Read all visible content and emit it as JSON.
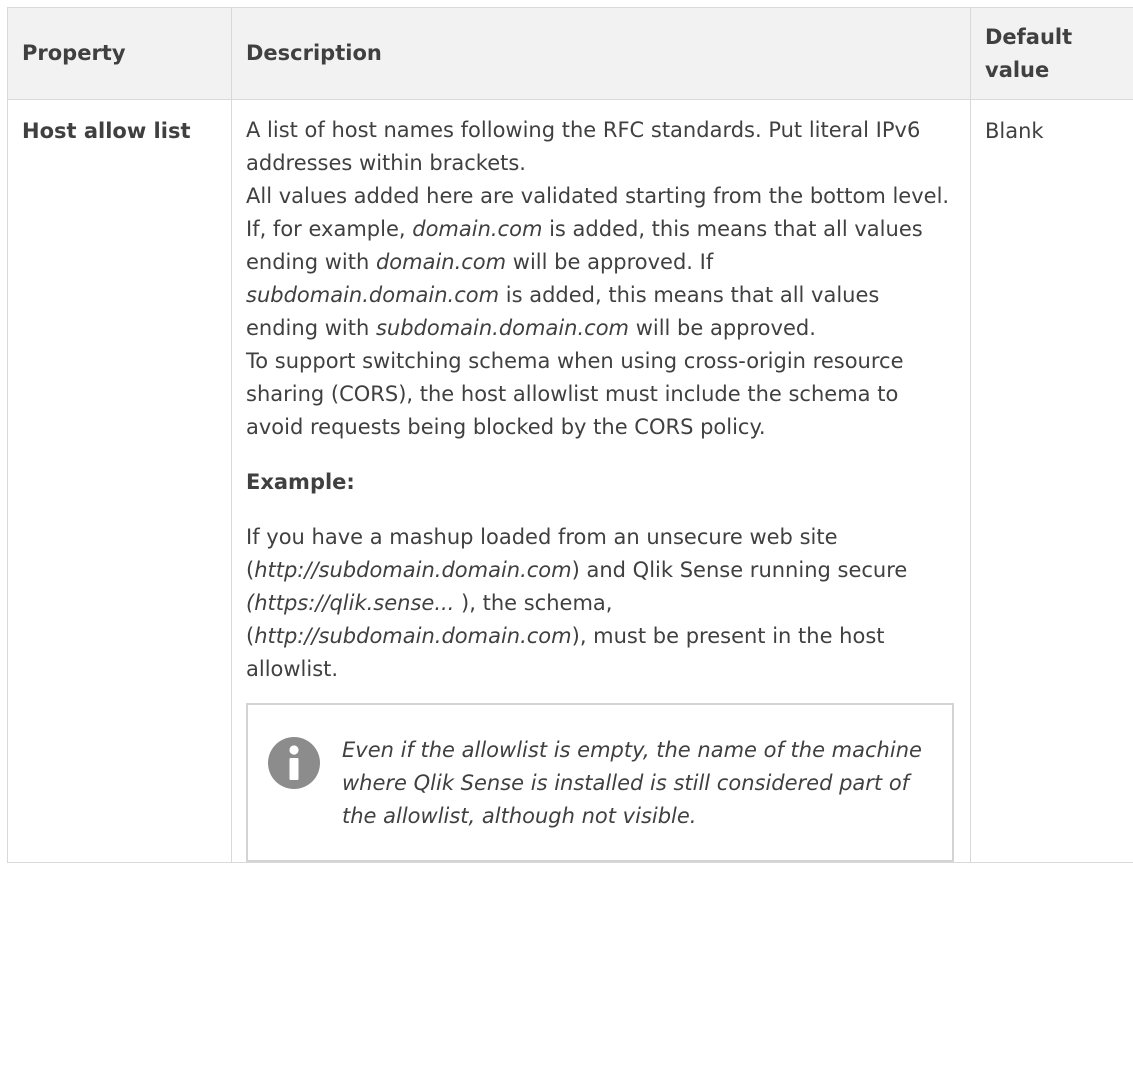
{
  "table": {
    "headers": {
      "property": "Property",
      "description": "Description",
      "default_line1": "Default",
      "default_line2": "value"
    },
    "rows": [
      {
        "property": "Host allow list",
        "default": "Blank",
        "description": {
          "line1": "A list of host names following the RFC standards. Put literal IPv6 addresses within brackets.",
          "p2_a": "All values added here are validated starting from the bottom level. If, for example, ",
          "p2_b_italic": "domain.com",
          "p2_c": " is added, this means that all values ending with ",
          "p2_d_italic": "domain.com",
          "p2_e": " will be approved. If ",
          "p2_f_italic": "subdomain.domain.com",
          "p2_g": " is added, this means that all values ending with ",
          "p2_h_italic": "subdomain.domain.com",
          "p2_i": " will be approved.",
          "p3": "To support switching schema when using cross-origin resource sharing (CORS), the host allowlist must include the schema to avoid requests being blocked by the CORS policy.",
          "example_heading": "Example:",
          "ex_a": "If you have a mashup loaded from an unsecure web site (",
          "ex_b_italic": "http://subdomain.domain.com",
          "ex_c": ") and Qlik Sense running secure ",
          "ex_d_italic": "(https://qlik.sense... ",
          "ex_e": "), the schema, (",
          "ex_f_italic": "http://subdomain.domain.com",
          "ex_g": "), must be present in the host allowlist.",
          "note": "Even if the allowlist is empty, the name of the machine where Qlik Sense is installed is still considered part of the allowlist, although not visible."
        }
      }
    ]
  },
  "icons": {
    "note_icon": "info-icon"
  },
  "colors": {
    "header_bg": "#f2f2f2",
    "border": "#d9d9d9",
    "text": "#404040",
    "icon": "#8c8c8c"
  }
}
